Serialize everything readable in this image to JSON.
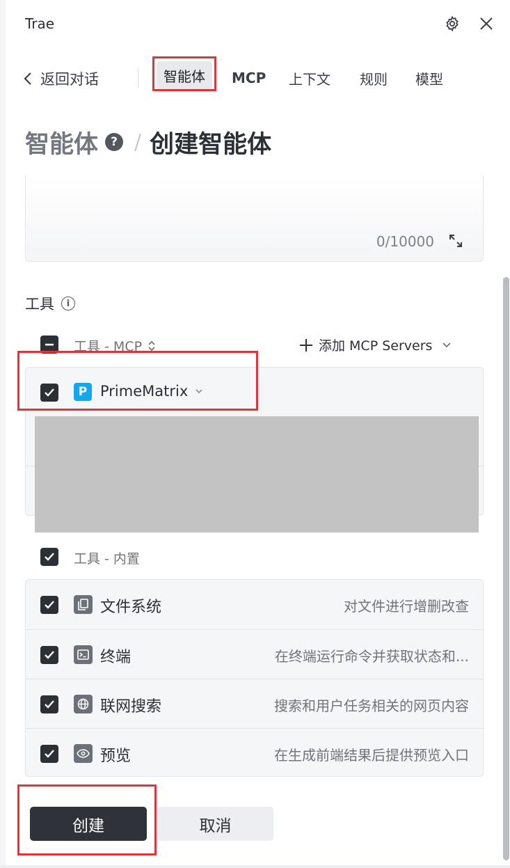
{
  "app": {
    "title": "Trae"
  },
  "nav": {
    "back_label": "返回对话",
    "tabs": [
      "智能体",
      "MCP",
      "上下文",
      "规则",
      "模型"
    ],
    "active_tab": "智能体"
  },
  "page": {
    "breadcrumb_root": "智能体",
    "breadcrumb_current": "创建智能体",
    "help_glyph": "?"
  },
  "prompt": {
    "counter": "0/10000"
  },
  "tools": {
    "section_label": "工具",
    "mcp_group": {
      "label": "工具 - MCP",
      "add_label": "添加 MCP Servers",
      "server": {
        "logo_letter": "P",
        "name": "PrimeMatrix",
        "checked": true
      }
    },
    "builtin_group": {
      "label": "工具 - 内置",
      "items": [
        {
          "name": "文件系统",
          "desc": "对文件进行增删改查",
          "icon": "file-icon",
          "checked": true
        },
        {
          "name": "终端",
          "desc": "在终端运行命令并获取状态和...",
          "icon": "terminal-icon",
          "checked": true
        },
        {
          "name": "联网搜索",
          "desc": "搜索和用户任务相关的网页内容",
          "icon": "globe-icon",
          "checked": true
        },
        {
          "name": "预览",
          "desc": "在生成前端结果后提供预览入口",
          "icon": "eye-icon",
          "checked": true
        }
      ]
    }
  },
  "actions": {
    "create_label": "创建",
    "cancel_label": "取消"
  },
  "colors": {
    "highlight": "#e53238",
    "primary_button": "#2f3238",
    "mcp_logo": "#13a8ee"
  }
}
